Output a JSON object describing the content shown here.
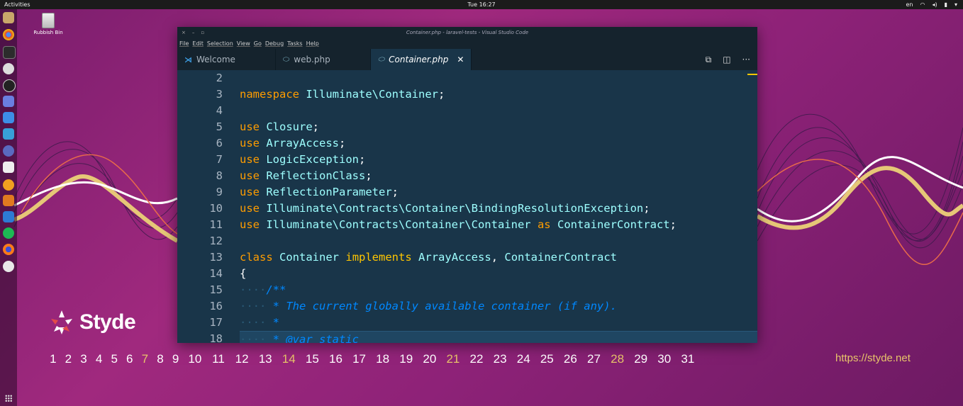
{
  "topbar": {
    "activities": "Activities",
    "clock": "Tue 16:27",
    "language": "en"
  },
  "desktop": {
    "trash_label": "Rubbish Bin"
  },
  "window": {
    "title": "Container.php - laravel-tests - Visual Studio Code",
    "menu": [
      "File",
      "Edit",
      "Selection",
      "View",
      "Go",
      "Debug",
      "Tasks",
      "Help"
    ],
    "tabs": [
      {
        "label": "Welcome",
        "icon": "vscode-icon"
      },
      {
        "label": "web.php",
        "icon": "php-icon"
      },
      {
        "label": "Container.php",
        "icon": "php-icon",
        "active": true
      }
    ],
    "close_glyph": "✕"
  },
  "editor": {
    "lines": [
      {
        "n": "2",
        "tokens": []
      },
      {
        "n": "3",
        "tokens": [
          [
            "k",
            "namespace"
          ],
          [
            "t",
            " "
          ],
          [
            "c",
            "Illuminate\\Container"
          ],
          [
            "t",
            ";"
          ]
        ]
      },
      {
        "n": "4",
        "tokens": []
      },
      {
        "n": "5",
        "tokens": [
          [
            "k",
            "use"
          ],
          [
            "t",
            " "
          ],
          [
            "c",
            "Closure"
          ],
          [
            "t",
            ";"
          ]
        ]
      },
      {
        "n": "6",
        "tokens": [
          [
            "k",
            "use"
          ],
          [
            "t",
            " "
          ],
          [
            "c",
            "ArrayAccess"
          ],
          [
            "t",
            ";"
          ]
        ]
      },
      {
        "n": "7",
        "tokens": [
          [
            "k",
            "use"
          ],
          [
            "t",
            " "
          ],
          [
            "c",
            "LogicException"
          ],
          [
            "t",
            ";"
          ]
        ]
      },
      {
        "n": "8",
        "tokens": [
          [
            "k",
            "use"
          ],
          [
            "t",
            " "
          ],
          [
            "c",
            "ReflectionClass"
          ],
          [
            "t",
            ";"
          ]
        ]
      },
      {
        "n": "9",
        "tokens": [
          [
            "k",
            "use"
          ],
          [
            "t",
            " "
          ],
          [
            "c",
            "ReflectionParameter"
          ],
          [
            "t",
            ";"
          ]
        ]
      },
      {
        "n": "10",
        "tokens": [
          [
            "k",
            "use"
          ],
          [
            "t",
            " "
          ],
          [
            "c",
            "Illuminate\\Contracts\\Container\\BindingResolutionException"
          ],
          [
            "t",
            ";"
          ]
        ]
      },
      {
        "n": "11",
        "tokens": [
          [
            "k",
            "use"
          ],
          [
            "t",
            " "
          ],
          [
            "c",
            "Illuminate\\Contracts\\Container\\Container"
          ],
          [
            "t",
            " "
          ],
          [
            "k",
            "as"
          ],
          [
            "t",
            " "
          ],
          [
            "c",
            "ContainerContract"
          ],
          [
            "t",
            ";"
          ]
        ]
      },
      {
        "n": "12",
        "tokens": []
      },
      {
        "n": "13",
        "tokens": [
          [
            "k",
            "class"
          ],
          [
            "t",
            " "
          ],
          [
            "c",
            "Container"
          ],
          [
            "t",
            " "
          ],
          [
            "y",
            "implements"
          ],
          [
            "t",
            " "
          ],
          [
            "c",
            "ArrayAccess"
          ],
          [
            "t",
            ", "
          ],
          [
            "c",
            "ContainerContract"
          ]
        ]
      },
      {
        "n": "14",
        "tokens": [
          [
            "t",
            "{"
          ]
        ]
      },
      {
        "n": "15",
        "tokens": [
          [
            "d",
            "····"
          ],
          [
            "cm",
            "/**"
          ]
        ]
      },
      {
        "n": "16",
        "tokens": [
          [
            "d",
            "····"
          ],
          [
            "cm",
            " * The current globally available container (if any)."
          ]
        ]
      },
      {
        "n": "17",
        "tokens": [
          [
            "d",
            "····"
          ],
          [
            "cm",
            " *"
          ]
        ]
      },
      {
        "n": "18",
        "tokens": [
          [
            "d",
            "····"
          ],
          [
            "cm",
            " * @var static"
          ]
        ]
      }
    ]
  },
  "wallpaper": {
    "brand": "Styde",
    "calendar_days": [
      "1",
      "2",
      "3",
      "4",
      "5",
      "6",
      "7",
      "8",
      "9",
      "10",
      "11",
      "12",
      "13",
      "14",
      "15",
      "16",
      "17",
      "18",
      "19",
      "20",
      "21",
      "22",
      "23",
      "24",
      "25",
      "26",
      "27",
      "28",
      "29",
      "30",
      "31"
    ],
    "highlight_days": [
      "7",
      "14",
      "21",
      "28"
    ],
    "site": "https://styde.net"
  },
  "colors": {
    "editor_bg": "#193549",
    "accent": "#ffc600",
    "keyword": "#ff9d00",
    "class": "#9effff",
    "comment": "#0088ff"
  }
}
